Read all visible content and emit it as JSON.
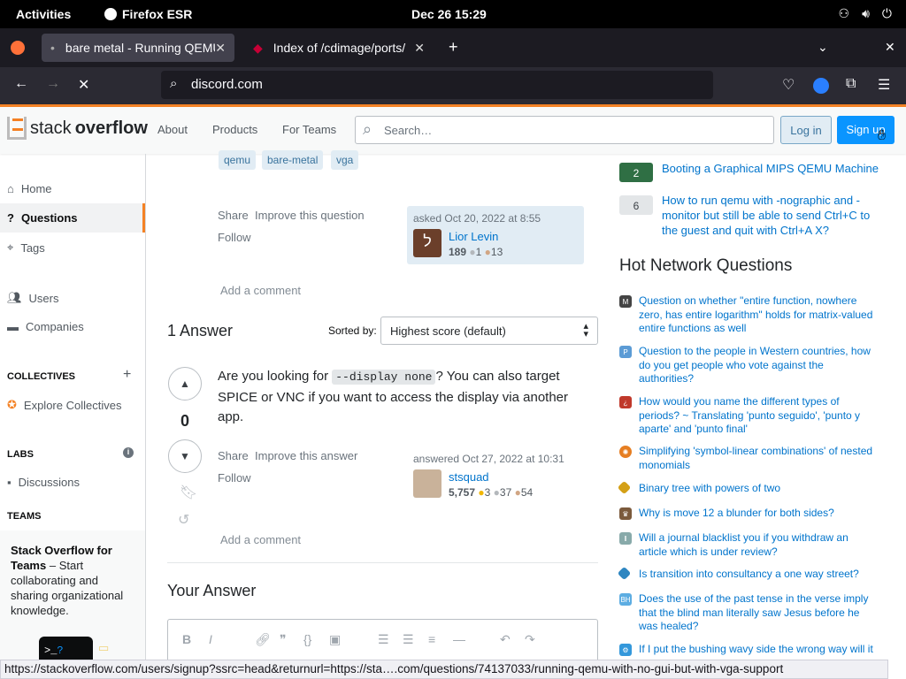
{
  "system": {
    "activities": "Activities",
    "app": "Firefox ESR",
    "clock": "Dec 26  15:29"
  },
  "browser": {
    "tabs": [
      {
        "title": "bare metal - Running QEMU"
      },
      {
        "title": "Index of /cdimage/ports/"
      }
    ],
    "url": "discord.com",
    "status_url": "https://stackoverflow.com/users/signup?ssrc=head&returnurl=https://sta….com/questions/74137033/running-qemu-with-no-gui-but-with-vga-support"
  },
  "header": {
    "logo_a": "stack",
    "logo_b": "overflow",
    "nav": [
      "About",
      "Products",
      "For Teams"
    ],
    "search_placeholder": "Search…",
    "login": "Log in",
    "signup": "Sign up"
  },
  "leftnav": {
    "home": "Home",
    "questions": "Questions",
    "tags": "Tags",
    "users": "Users",
    "companies": "Companies",
    "collectives_head": "COLLECTIVES",
    "explore": "Explore Collectives",
    "labs_head": "LABS",
    "discussions": "Discussions",
    "teams_head": "TEAMS",
    "teams_title": "Stack Overflow for Teams",
    "teams_text": " – Start collaborating and sharing organizational knowledge."
  },
  "question": {
    "tags": [
      "qemu",
      "bare-metal",
      "vga"
    ],
    "share": "Share",
    "improve": "Improve this question",
    "follow": "Follow",
    "asked": "asked Oct 20, 2022 at 8:55",
    "user": "Lior Levin",
    "rep": "189",
    "silver": "1",
    "bronze": "13",
    "add_comment": "Add a comment"
  },
  "answers": {
    "count_label": "1 Answer",
    "sorted_by": "Sorted by:",
    "sort_value": "Highest score (default)"
  },
  "answer": {
    "score": "0",
    "text_a": "Are you looking for ",
    "code": "--display none",
    "text_b": "? You can also target SPICE or VNC if you want to access the display via another app.",
    "share": "Share",
    "improve": "Improve this answer",
    "follow": "Follow",
    "answered": "answered Oct 27, 2022 at 10:31",
    "user": "stsquad",
    "rep": "5,757",
    "gold": "3",
    "silver": "37",
    "bronze": "54",
    "add_comment": "Add a comment"
  },
  "your_answer": "Your Answer",
  "related": [
    {
      "count": "2",
      "title": "Booting a Graphical MIPS QEMU Machine",
      "answered": true
    },
    {
      "count": "6",
      "title": "How to run qemu with -nographic and -monitor but still be able to send Ctrl+C to the guest and quit with Ctrl+A X?",
      "answered": false
    }
  ],
  "hnq_title": "Hot Network Questions",
  "hnq": [
    {
      "title": "Question on whether \"entire function, nowhere zero, has entire logarithm\" holds for matrix-valued entire functions as well",
      "icon_color": "#444"
    },
    {
      "title": "Question to the people in Western countries, how do you get people who vote against the authorities?",
      "icon_color": "#5b9bd5"
    },
    {
      "title": "How would you name the different types of periods? ~ Translating 'punto seguido', 'punto y aparte' and 'punto final'",
      "icon_color": "#c0392b"
    },
    {
      "title": "Simplifying 'symbol-linear combinations' of nested monomials",
      "icon_color": "#e67e22"
    },
    {
      "title": "Binary tree with powers of two",
      "icon_color": "#d4a017"
    },
    {
      "title": "Why is move 12 a blunder for both sides?",
      "icon_color": "#7b5a3c"
    },
    {
      "title": "Will a journal blacklist you if you withdraw an article which is under review?",
      "icon_color": "#8aa"
    },
    {
      "title": "Is transition into consultancy a one way street?",
      "icon_color": "#2e86c1"
    },
    {
      "title": "Does the use of the past tense in the verse imply that the blind man literally saw Jesus before he was healed?",
      "icon_color": "#5dade2"
    },
    {
      "title": "If I put the bushing wavy side the wrong way will it",
      "icon_color": "#3498db"
    }
  ]
}
